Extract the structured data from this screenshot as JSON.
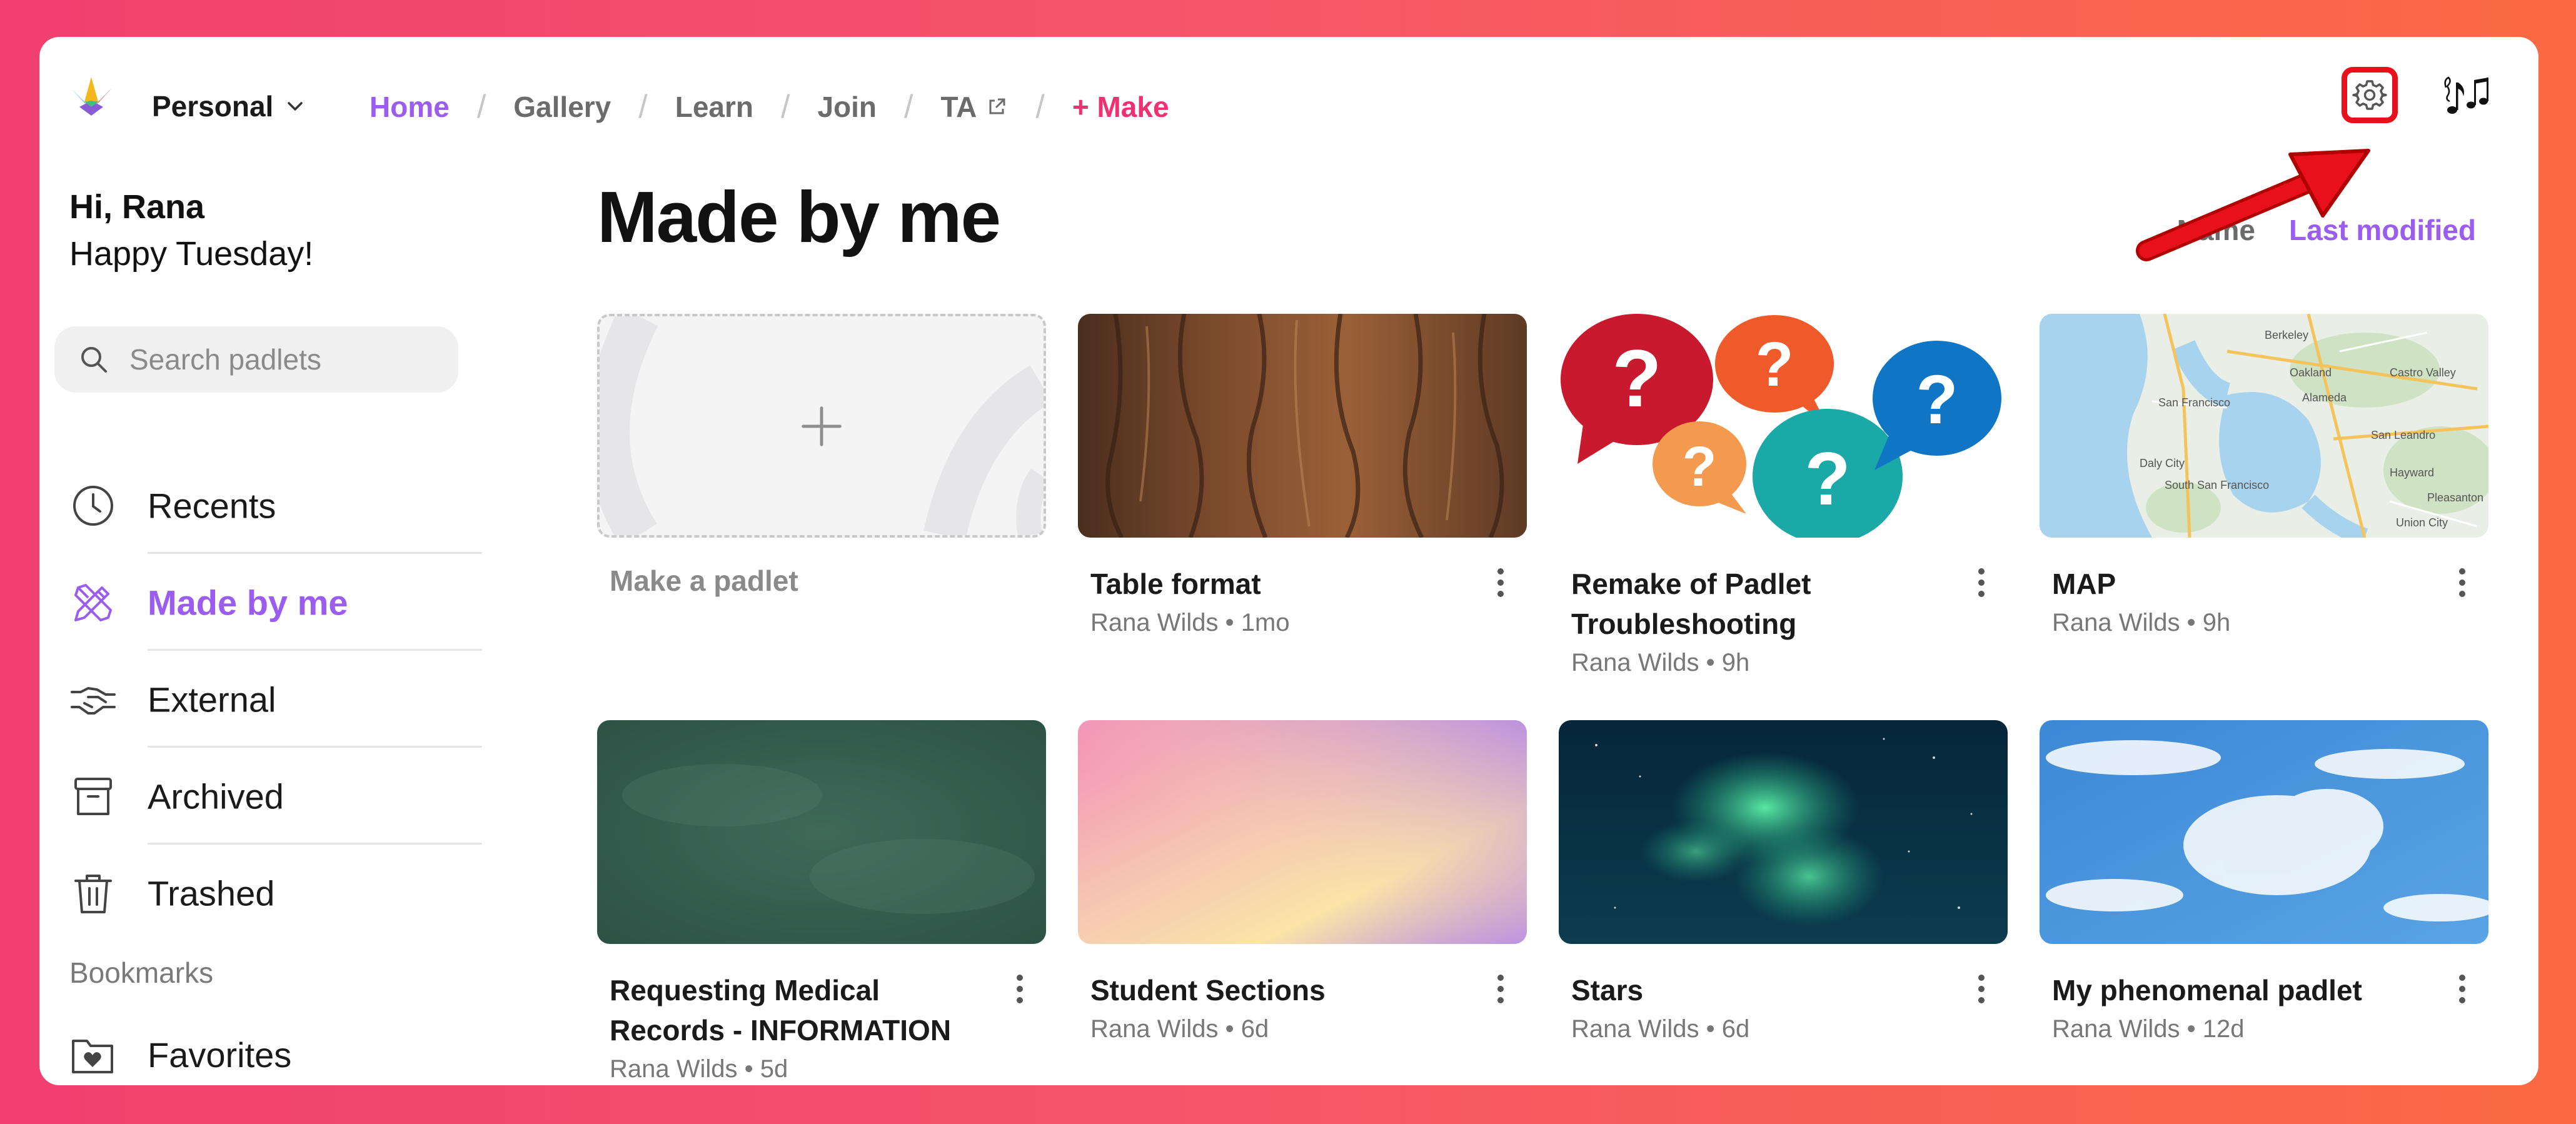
{
  "header": {
    "workspace": "Personal",
    "nav": [
      "Home",
      "Gallery",
      "Learn",
      "Join",
      "TA",
      "+ Make"
    ],
    "separator": "/"
  },
  "sidebar": {
    "greeting_name": "Hi, Rana",
    "greeting_message": "Happy Tuesday!",
    "search_placeholder": "Search padlets",
    "items": [
      {
        "label": "Recents",
        "icon": "clock-icon"
      },
      {
        "label": "Made by me",
        "icon": "pencil-ruler-icon",
        "active": true
      },
      {
        "label": "External",
        "icon": "handshake-icon"
      },
      {
        "label": "Archived",
        "icon": "archive-box-icon"
      },
      {
        "label": "Trashed",
        "icon": "trash-icon"
      }
    ],
    "bookmarks_heading": "Bookmarks",
    "favorites_label": "Favorites"
  },
  "main": {
    "title": "Made by me",
    "sort_options": [
      "Name",
      "Last modified"
    ],
    "sort_active": "Last modified",
    "make_label": "Make a padlet",
    "cards": [
      {
        "title": "Table format",
        "author": "Rana Wilds",
        "age": "1mo",
        "thumbnail": "tree-bark"
      },
      {
        "title": "Remake of Padlet Troubleshooting",
        "author": "Rana Wilds",
        "age": "9h",
        "thumbnail": "question-bubbles"
      },
      {
        "title": "MAP",
        "author": "Rana Wilds",
        "age": "9h",
        "thumbnail": "bay-area-map"
      },
      {
        "title": "Requesting Medical Records - INFORMATION",
        "author": "Rana Wilds",
        "age": "5d",
        "thumbnail": "green-chalkboard"
      },
      {
        "title": "Student Sections",
        "author": "Rana Wilds",
        "age": "6d",
        "thumbnail": "pastel-gradient"
      },
      {
        "title": "Stars",
        "author": "Rana Wilds",
        "age": "6d",
        "thumbnail": "aurora"
      },
      {
        "title": "My phenomenal padlet",
        "author": "Rana Wilds",
        "age": "12d",
        "thumbnail": "sky-clouds"
      }
    ],
    "meta_separator": "•"
  },
  "colors": {
    "accent": "#9b5cf0",
    "make": "#f0306f",
    "highlight": "#e8101b"
  }
}
